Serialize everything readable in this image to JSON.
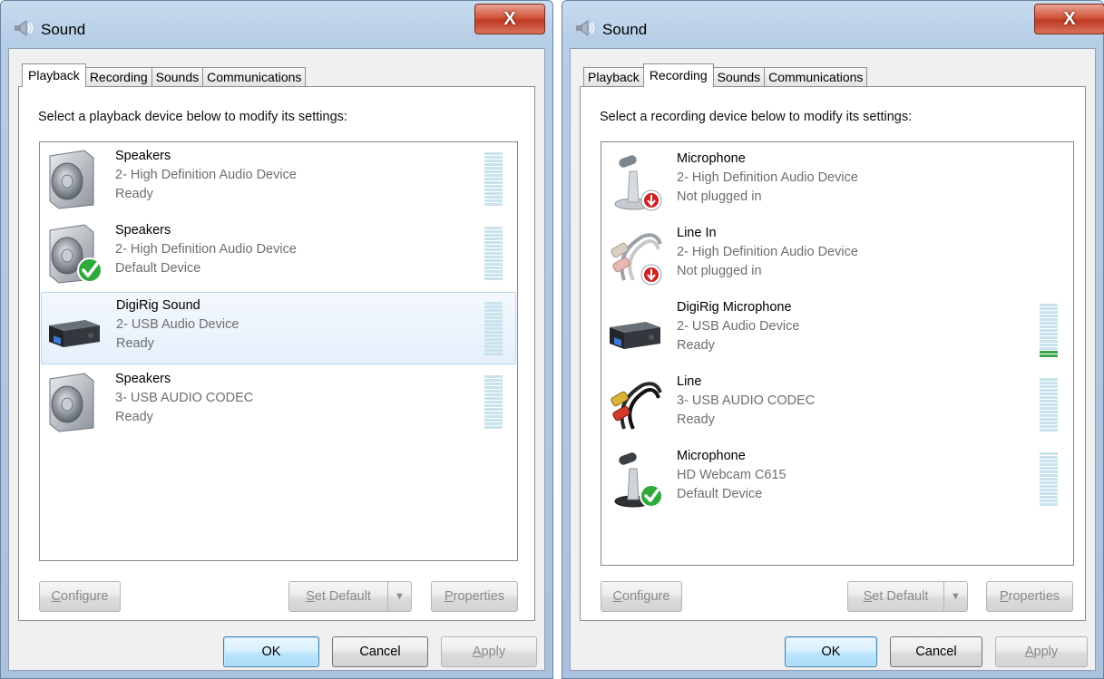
{
  "left_window": {
    "title": "Sound",
    "close_glyph": "X",
    "tabs": [
      {
        "label": "Playback",
        "active": true
      },
      {
        "label": "Recording",
        "active": false
      },
      {
        "label": "Sounds",
        "active": false
      },
      {
        "label": "Communications",
        "active": false
      }
    ],
    "instruction": "Select a playback device below to modify its settings:",
    "devices": [
      {
        "name": "Speakers",
        "device": "2- High Definition Audio Device",
        "status": "Ready",
        "icon": "speaker-icon",
        "badge": null,
        "level_segments_on": 0
      },
      {
        "name": "Speakers",
        "device": "2- High Definition Audio Device",
        "status": "Default Device",
        "icon": "speaker-icon",
        "badge": "green-check",
        "level_segments_on": 0
      },
      {
        "name": "DigiRig Sound",
        "device": "2- USB Audio Device",
        "status": "Ready",
        "icon": "usb-audio-device-icon",
        "badge": null,
        "selected": true,
        "level_segments_on": 0
      },
      {
        "name": "Speakers",
        "device": "3- USB AUDIO  CODEC",
        "status": "Ready",
        "icon": "speaker-icon",
        "badge": null,
        "level_segments_on": 0
      }
    ],
    "buttons": {
      "configure": {
        "prefix": "",
        "accel": "C",
        "rest": "onfigure"
      },
      "set_default": {
        "prefix": "",
        "accel": "S",
        "rest": "et Default"
      },
      "properties": {
        "prefix": "",
        "accel": "P",
        "rest": "roperties"
      },
      "ok": "OK",
      "cancel": "Cancel",
      "apply": {
        "prefix": "",
        "accel": "A",
        "rest": "pply"
      }
    }
  },
  "right_window": {
    "title": "Sound",
    "close_glyph": "X",
    "tabs": [
      {
        "label": "Playback",
        "active": false
      },
      {
        "label": "Recording",
        "active": true
      },
      {
        "label": "Sounds",
        "active": false
      },
      {
        "label": "Communications",
        "active": false
      }
    ],
    "instruction": "Select a recording device below to modify its settings:",
    "devices": [
      {
        "name": "Microphone",
        "device": "2- High Definition Audio Device",
        "status": "Not plugged in",
        "icon": "microphone-icon",
        "badge": "red-unplugged"
      },
      {
        "name": "Line In",
        "device": "2- High Definition Audio Device",
        "status": "Not plugged in",
        "icon": "rca-cable-icon",
        "badge": "red-unplugged"
      },
      {
        "name": "DigiRig Microphone",
        "device": "2- USB Audio Device",
        "status": "Ready",
        "icon": "usb-audio-device-icon",
        "badge": null,
        "level_segments_on": 2
      },
      {
        "name": "Line",
        "device": "3- USB AUDIO  CODEC",
        "status": "Ready",
        "icon": "rca-cable-icon",
        "badge": null,
        "level_segments_on": 0
      },
      {
        "name": "Microphone",
        "device": "HD Webcam C615",
        "status": "Default Device",
        "icon": "microphone-icon",
        "badge": "green-check",
        "level_segments_on": 0
      }
    ],
    "buttons": {
      "configure": {
        "prefix": "",
        "accel": "C",
        "rest": "onfigure"
      },
      "set_default": {
        "prefix": "",
        "accel": "S",
        "rest": "et Default"
      },
      "properties": {
        "prefix": "",
        "accel": "P",
        "rest": "roperties"
      },
      "ok": "OK",
      "cancel": "Cancel",
      "apply": {
        "prefix": "",
        "accel": "A",
        "rest": "pply"
      }
    }
  },
  "colors": {
    "titlebar": "#b6cde6",
    "close_button": "#c8462f",
    "selection_fill": "#e5f0fb",
    "selection_border": "#b9d7f3",
    "meter_idle": "#c8e3ec",
    "meter_active": "#39a84b",
    "check_green": "#2faa3a",
    "unplugged_red": "#cc2222"
  }
}
